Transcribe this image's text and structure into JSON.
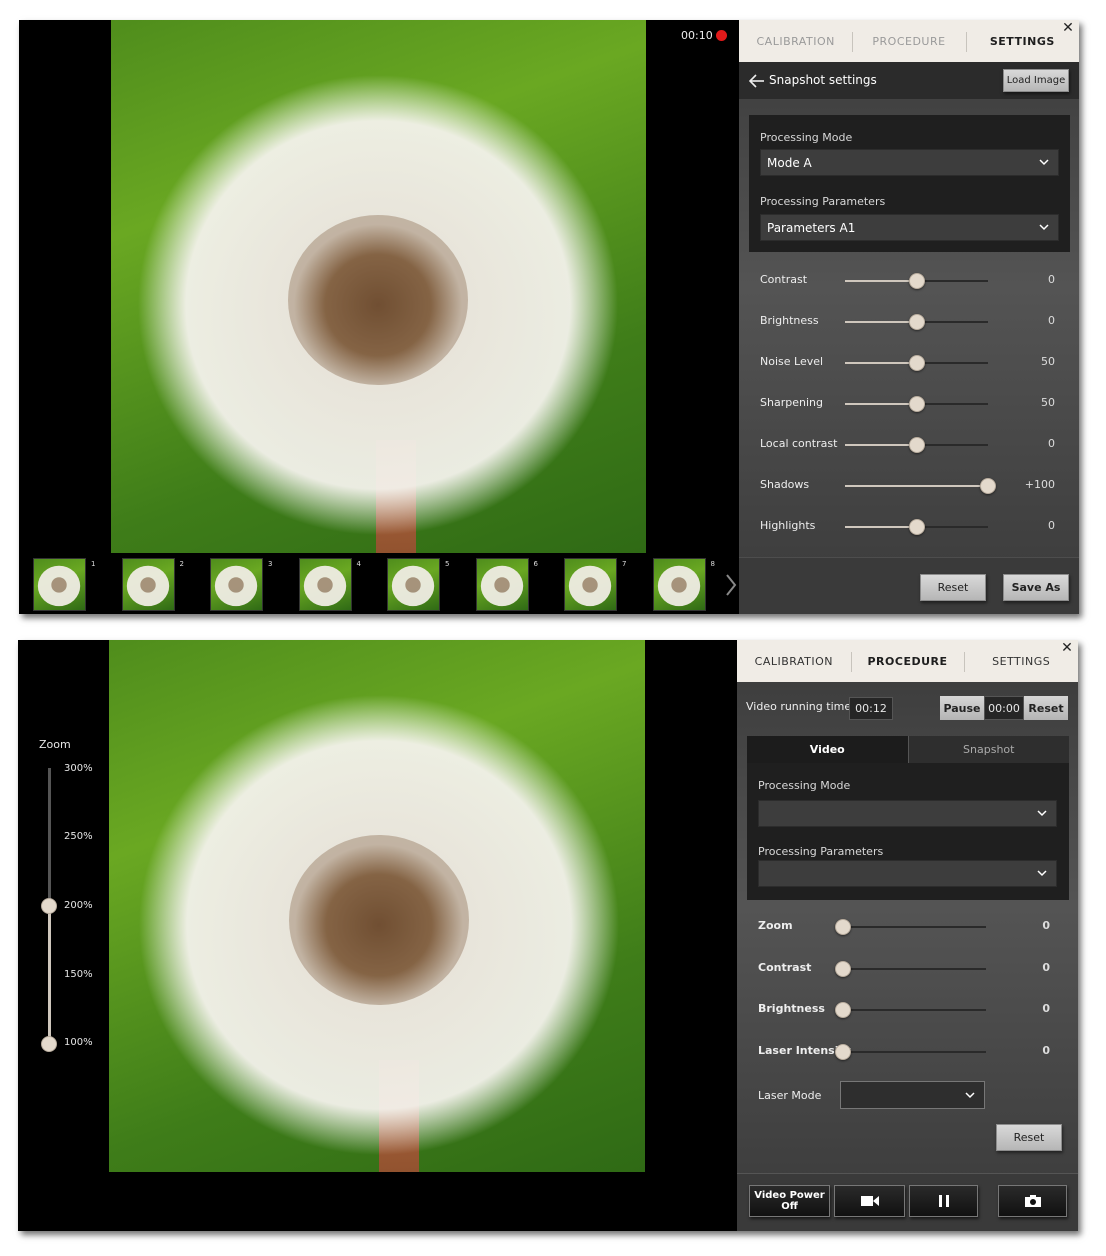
{
  "colors": {
    "record_dot": "#e21a1a",
    "panel_tabs_bg": "#f0ece6",
    "slider_knob": "#e3d9cc"
  },
  "top": {
    "timer": "00:10",
    "tabs": [
      {
        "label": "CALIBRATION",
        "active": false
      },
      {
        "label": "PROCEDURE",
        "active": false
      },
      {
        "label": "SETTINGS",
        "active": true
      }
    ],
    "header_title": "Snapshot settings",
    "load_image_label": "Load Image",
    "processing_mode_label": "Processing Mode",
    "processing_mode_value": "Mode A",
    "processing_params_label": "Processing Parameters",
    "processing_params_value": "Parameters A1",
    "sliders": [
      {
        "label": "Contrast",
        "value": "0",
        "level": 0.5
      },
      {
        "label": "Brightness",
        "value": "0",
        "level": 0.5
      },
      {
        "label": "Noise Level",
        "value": "50",
        "level": 0.5
      },
      {
        "label": "Sharpening",
        "value": "50",
        "level": 0.5
      },
      {
        "label": "Local contrast",
        "value": "0",
        "level": 0.5
      },
      {
        "label": "Shadows",
        "value": "+100",
        "level": 1.0
      },
      {
        "label": "Highlights",
        "value": "0",
        "level": 0.5
      }
    ],
    "reset_label": "Reset",
    "save_as_label": "Save As",
    "thumbnails": [
      "1",
      "2",
      "3",
      "4",
      "5",
      "6",
      "7",
      "8"
    ]
  },
  "bottom": {
    "tabs": [
      {
        "label": "CALIBRATION",
        "active": false
      },
      {
        "label": "PROCEDURE",
        "active": true
      },
      {
        "label": "SETTINGS",
        "active": false
      }
    ],
    "video_running_label": "Video running time",
    "video_running_value": "00:12",
    "pause_label": "Pause",
    "counter_value": "00:00",
    "reset_timer_label": "Reset",
    "subtabs": [
      {
        "label": "Video",
        "active": true
      },
      {
        "label": "Snapshot",
        "active": false
      }
    ],
    "processing_mode_label": "Processing Mode",
    "processing_mode_value": "",
    "processing_params_label": "Processing Parameters",
    "processing_params_value": "",
    "sliders": [
      {
        "label": "Zoom",
        "value": "0",
        "level": 0.0
      },
      {
        "label": "Contrast",
        "value": "0",
        "level": 0.0
      },
      {
        "label": "Brightness",
        "value": "0",
        "level": 0.0
      },
      {
        "label": "Laser Intensity",
        "value": "0",
        "level": 0.0
      }
    ],
    "laser_mode_label": "Laser Mode",
    "laser_mode_value": "",
    "reset_label": "Reset",
    "video_power_label": "Video Power Off",
    "zoom": {
      "title": "Zoom",
      "ticks": [
        "300%",
        "250%",
        "200%",
        "150%",
        "100%"
      ],
      "level": 0.5
    }
  }
}
